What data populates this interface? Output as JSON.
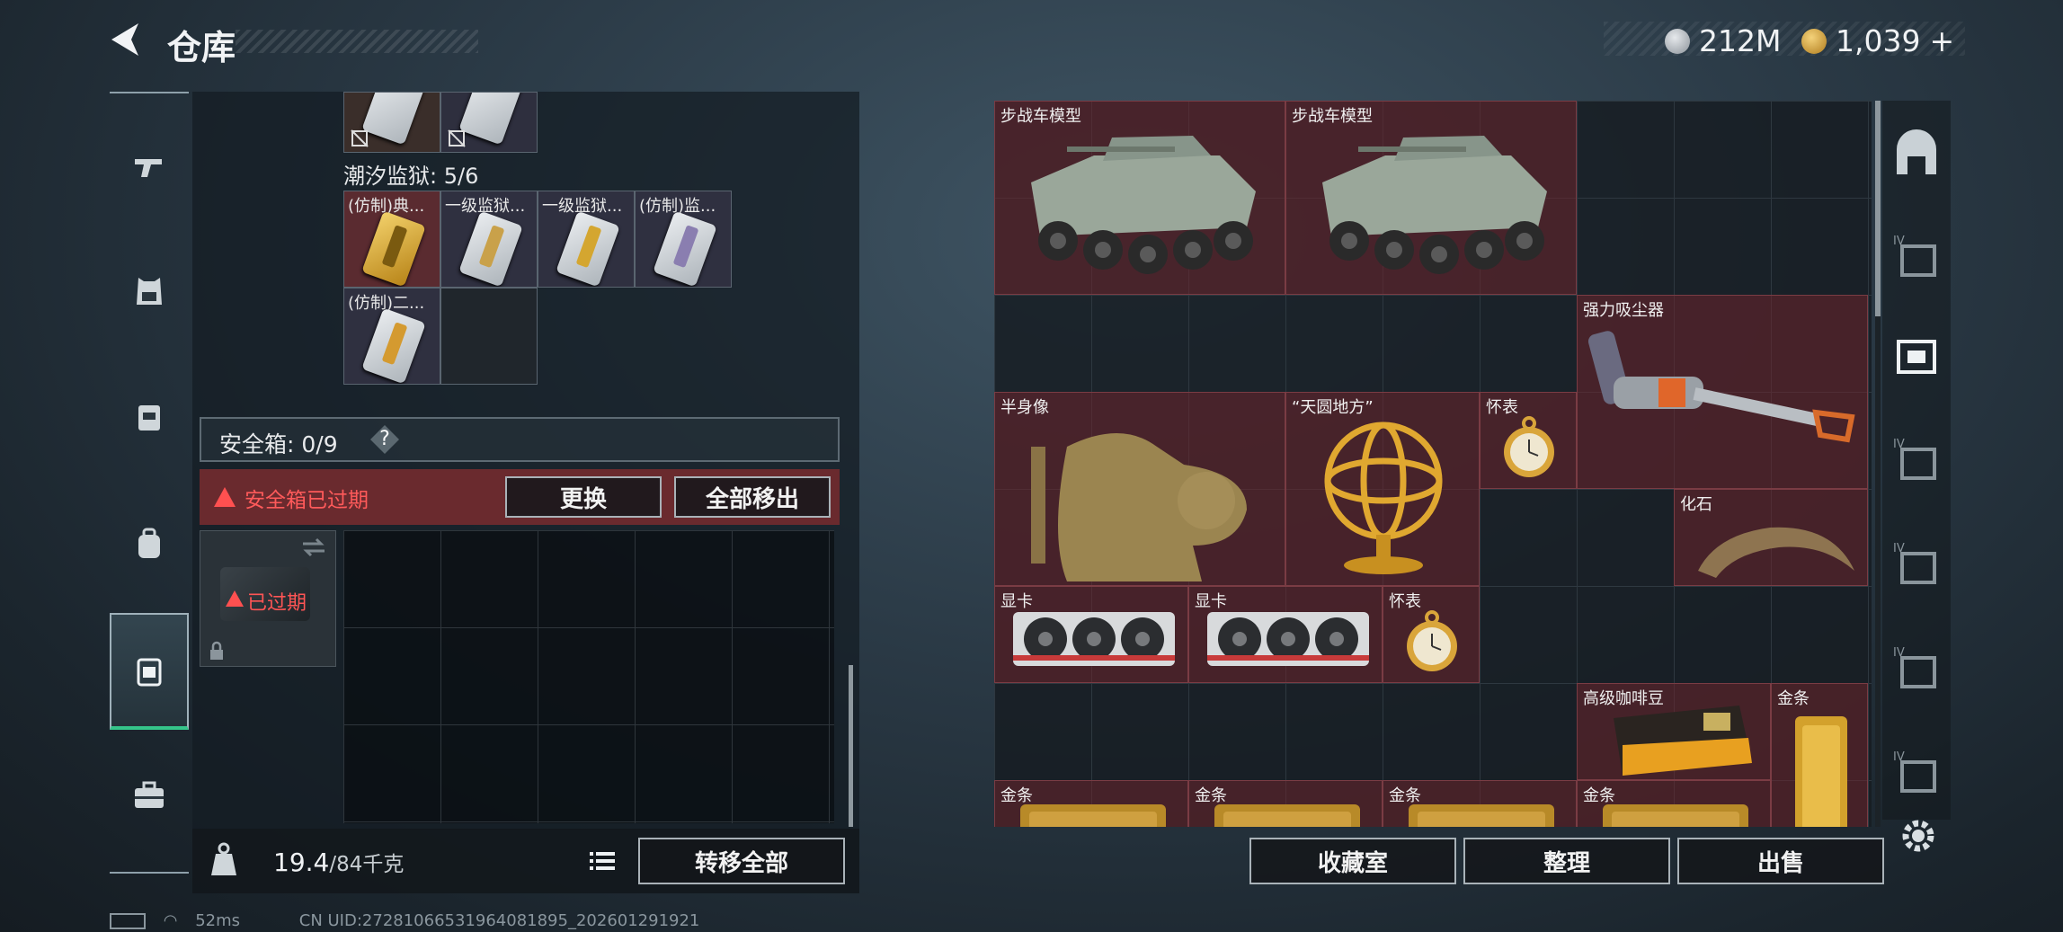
{
  "header": {
    "title": "仓库",
    "currency": [
      {
        "icon": "silver-coin-icon",
        "value": "212M",
        "color": "#c9ccd1"
      },
      {
        "icon": "gold-coin-icon",
        "value": "1,039",
        "plus": "+",
        "color": "#e0b04c"
      }
    ]
  },
  "tabs": [
    {
      "icon": "gun-icon"
    },
    {
      "icon": "armor-vest-icon"
    },
    {
      "icon": "chest-rig-icon"
    },
    {
      "icon": "backpack-icon"
    },
    {
      "icon": "safebox-icon",
      "active": true
    },
    {
      "icon": "briefcase-icon"
    }
  ],
  "left": {
    "prison_label": "潮汐监狱: 5/6",
    "keycards": [
      {
        "label": "(仿制)典...",
        "color": "#d4a630",
        "highlight": true
      },
      {
        "label": "一级监狱...",
        "color": "#c9a14a"
      },
      {
        "label": "一级监狱...",
        "color": "#d4a630"
      },
      {
        "label": "(仿制)监...",
        "color": "#8a7eb0"
      },
      {
        "label": "(仿制)二...",
        "color": "#d49a30"
      }
    ],
    "safebox_label": "安全箱: 0/9",
    "help": "?",
    "expired_text": "安全箱已过期",
    "replace_btn": "更换",
    "move_all_btn": "全部移出",
    "safebox_item_text": "已过期",
    "weight_value": "19.4",
    "weight_max": "/84千克",
    "transfer_btn": "转移全部"
  },
  "grid_items": [
    {
      "name": "步战车模型",
      "type": "ifv"
    },
    {
      "name": "步战车模型",
      "type": "ifv"
    },
    {
      "name": "强力吸尘器",
      "type": "vacuum"
    },
    {
      "name": "半身像",
      "type": "bust"
    },
    {
      "name": "“天圆地方”",
      "type": "armillary"
    },
    {
      "name": "怀表",
      "type": "watch"
    },
    {
      "name": "化石",
      "type": "fossil"
    },
    {
      "name": "显卡",
      "type": "gpu"
    },
    {
      "name": "显卡",
      "type": "gpu"
    },
    {
      "name": "怀表",
      "type": "watch"
    },
    {
      "name": "高级咖啡豆",
      "type": "coffee"
    },
    {
      "name": "金条",
      "type": "gold-bar"
    },
    {
      "name": "金条",
      "type": "gold-bar"
    },
    {
      "name": "金条",
      "type": "gold-bar"
    },
    {
      "name": "金条",
      "type": "gold-bar"
    },
    {
      "name": "金条",
      "type": "gold-bar"
    }
  ],
  "footer": {
    "collection_btn": "收藏室",
    "sort_btn": "整理",
    "sell_btn": "出售"
  },
  "side_icons": [
    "vault-icon",
    "tier-iv-case-icon",
    "tier-iv-case-icon",
    "tier-iv-case-icon",
    "tier-iv-case-icon",
    "tier-iv-case-icon",
    "tier-iv-case-icon",
    "settings-gear-icon"
  ],
  "status": {
    "ping": "52ms",
    "uid": "CN UID:272810665319640818​95_202601291921"
  }
}
